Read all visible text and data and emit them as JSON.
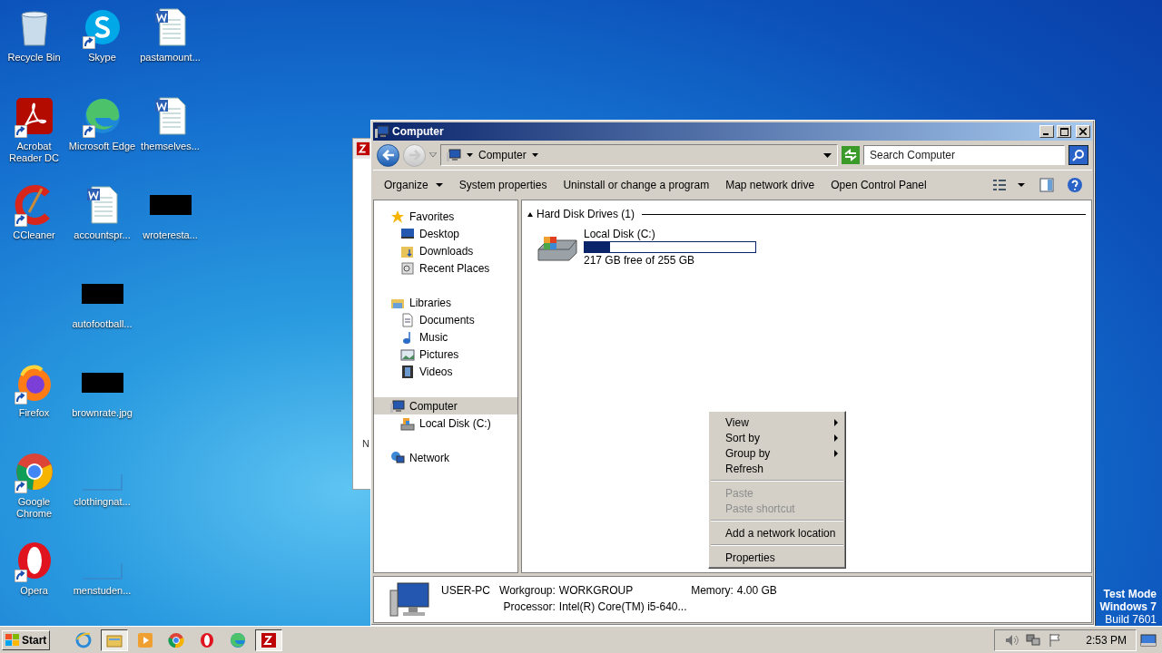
{
  "desktop_icons": [
    {
      "label": "Recycle Bin",
      "kind": "recycle",
      "shortcut": false
    },
    {
      "label": "Skype",
      "kind": "skype",
      "shortcut": true
    },
    {
      "label": "pastamount...",
      "kind": "word",
      "shortcut": false
    },
    {
      "label": "Acrobat Reader DC",
      "kind": "acrobat",
      "shortcut": true
    },
    {
      "label": "Microsoft Edge",
      "kind": "edge",
      "shortcut": true
    },
    {
      "label": "themselves...",
      "kind": "word",
      "shortcut": false
    },
    {
      "label": "CCleaner",
      "kind": "ccleaner",
      "shortcut": true
    },
    {
      "label": "accountspr...",
      "kind": "word",
      "shortcut": false
    },
    {
      "label": "wroteresta...",
      "kind": "redacted",
      "shortcut": false
    },
    {
      "label": "autofootball...",
      "kind": "redacted",
      "shortcut": false
    },
    {
      "label": "Firefox",
      "kind": "firefox",
      "shortcut": true
    },
    {
      "label": "brownrate.jpg",
      "kind": "redacted",
      "shortcut": false
    },
    {
      "label": "Google Chrome",
      "kind": "chrome",
      "shortcut": true
    },
    {
      "label": "clothingnat...",
      "kind": "blank",
      "shortcut": false
    },
    {
      "label": "Opera",
      "kind": "opera",
      "shortcut": true
    },
    {
      "label": "menstuden...",
      "kind": "blank",
      "shortcut": false
    }
  ],
  "background_window": {
    "status_text": "N"
  },
  "window": {
    "title": "Computer",
    "address": {
      "location": "Computer",
      "back_disabled": false,
      "forward_disabled": true
    },
    "search": {
      "placeholder": "Search Computer"
    },
    "toolbar": [
      {
        "label": "Organize",
        "dropdown": true
      },
      {
        "label": "System properties",
        "dropdown": false
      },
      {
        "label": "Uninstall or change a program",
        "dropdown": false
      },
      {
        "label": "Map network drive",
        "dropdown": false
      },
      {
        "label": "Open Control Panel",
        "dropdown": false
      }
    ],
    "sidebar": [
      {
        "label": "Favorites",
        "kind": "star",
        "selected": false,
        "children": [
          {
            "label": "Desktop",
            "kind": "desktop",
            "selected": false
          },
          {
            "label": "Downloads",
            "kind": "downloads",
            "selected": false
          },
          {
            "label": "Recent Places",
            "kind": "recent",
            "selected": false
          }
        ]
      },
      {
        "label": "Libraries",
        "kind": "libraries",
        "selected": false,
        "children": [
          {
            "label": "Documents",
            "kind": "document",
            "selected": false
          },
          {
            "label": "Music",
            "kind": "music",
            "selected": false
          },
          {
            "label": "Pictures",
            "kind": "pictures",
            "selected": false
          },
          {
            "label": "Videos",
            "kind": "videos",
            "selected": false
          }
        ]
      },
      {
        "label": "Computer",
        "kind": "computer",
        "selected": true,
        "children": [
          {
            "label": "Local Disk (C:)",
            "kind": "drive",
            "selected": false
          }
        ]
      },
      {
        "label": "Network",
        "kind": "network",
        "selected": false
      }
    ],
    "groups": [
      {
        "title": "Hard Disk Drives (1)",
        "expanded": true,
        "drives": [
          {
            "name": "Local Disk (C:)",
            "level": 0.15,
            "space": "217 GB free of 255 GB"
          }
        ]
      }
    ],
    "context_menu": {
      "groups": [
        {
          "items": [
            {
              "label": "View",
              "submenu": true,
              "disabled": false
            },
            {
              "label": "Sort by",
              "submenu": true,
              "disabled": false
            },
            {
              "label": "Group by",
              "submenu": true,
              "disabled": false
            },
            {
              "label": "Refresh",
              "submenu": false,
              "disabled": false
            }
          ]
        },
        {
          "items": [
            {
              "label": "Paste",
              "submenu": false,
              "disabled": true
            },
            {
              "label": "Paste shortcut",
              "submenu": false,
              "disabled": true
            }
          ]
        },
        {
          "items": [
            {
              "label": "Add a network location",
              "submenu": false,
              "disabled": false
            }
          ]
        },
        {
          "items": [
            {
              "label": "Properties",
              "submenu": false,
              "disabled": false
            }
          ]
        }
      ]
    },
    "details": {
      "name": "USER-PC",
      "fields": [
        {
          "label": "Workgroup:",
          "value": "WORKGROUP"
        },
        {
          "label": "Memory:",
          "value": "4.00 GB"
        },
        {
          "label": "Processor:",
          "value": "Intel(R) Core(TM) i5-640..."
        }
      ]
    }
  },
  "test_mode": [
    "Test Mode",
    "Windows 7",
    "Build 7601"
  ],
  "taskbar": {
    "start": "Start",
    "apps": [
      {
        "kind": "ie",
        "active": false
      },
      {
        "kind": "explorer",
        "active": true
      },
      {
        "kind": "media",
        "active": false
      },
      {
        "kind": "chrome",
        "active": false
      },
      {
        "kind": "opera",
        "active": false
      },
      {
        "kind": "edge",
        "active": false
      },
      {
        "kind": "filezilla",
        "active": true
      }
    ],
    "clock": "2:53 PM"
  }
}
